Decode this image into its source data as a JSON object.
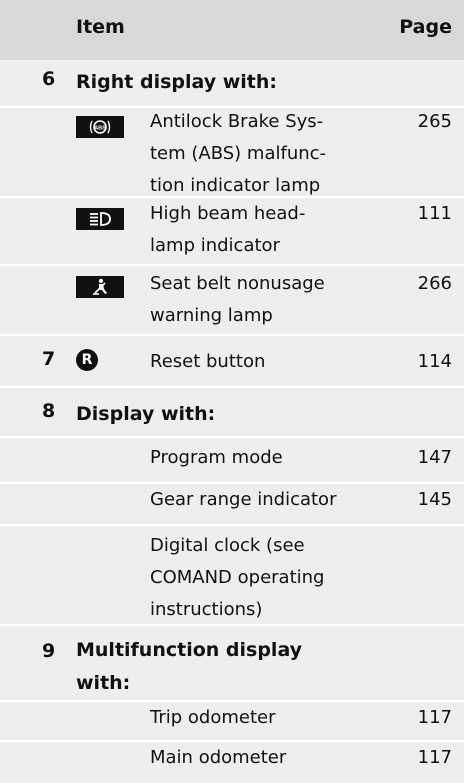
{
  "header": {
    "item": "Item",
    "page": "Page"
  },
  "rows": [
    {
      "num": "6",
      "label": "Right display with:"
    },
    {
      "icon": "abs-icon",
      "desc": "Antilock Brake Sys-\ntem (ABS) malfunc-\ntion indicator lamp",
      "page": "265"
    },
    {
      "icon": "high-beam-icon",
      "desc": "High beam head-\nlamp indicator",
      "page": "111"
    },
    {
      "icon": "seat-belt-icon",
      "desc": "Seat belt nonusage\nwarning lamp",
      "page": "266"
    },
    {
      "num": "7",
      "icon": "reset-icon",
      "icon_text": "R",
      "desc": "Reset button",
      "page": "114"
    },
    {
      "num": "8",
      "label": "Display with:"
    },
    {
      "desc": "Program mode",
      "page": "147"
    },
    {
      "desc": "Gear range indicator",
      "page": "145"
    },
    {
      "desc": "Digital clock (see\nCOMAND operating\ninstructions)",
      "page": ""
    },
    {
      "num": "9",
      "label": "Multifunction display\nwith:"
    },
    {
      "desc": "Trip odometer",
      "page": "117"
    },
    {
      "desc": "Main odometer",
      "page": "117"
    }
  ],
  "colors": {
    "header_bg": "#d9d9d9",
    "row_bg": "#eeeeee",
    "icon_bg": "#111111",
    "icon_fg": "#ffffff"
  }
}
